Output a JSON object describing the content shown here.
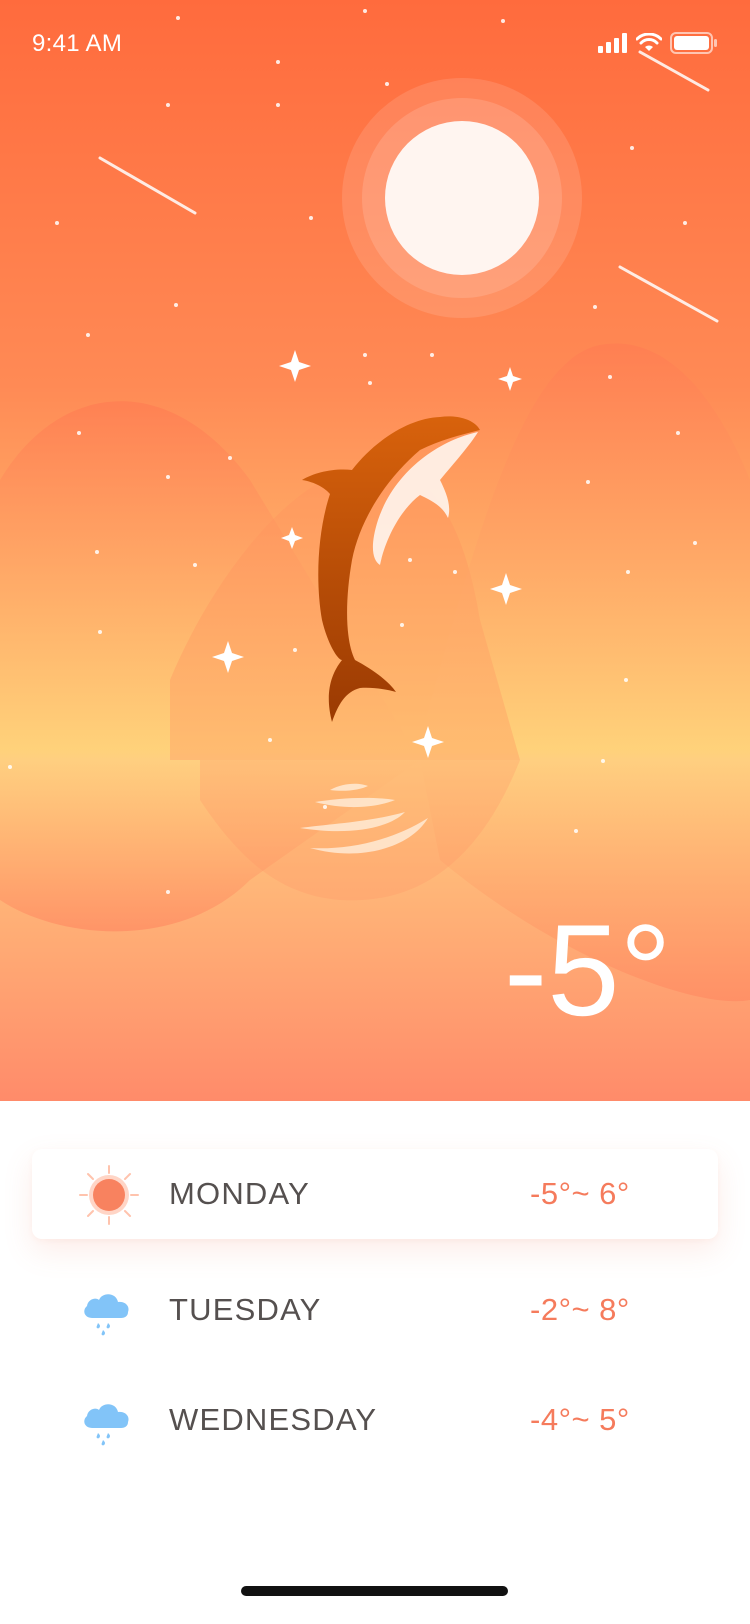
{
  "status_bar": {
    "time": "9:41 AM"
  },
  "current": {
    "temperature": "-5°"
  },
  "forecast": [
    {
      "day": "MONDAY",
      "range": "-5°~ 6°",
      "icon": "sun-icon"
    },
    {
      "day": "TUESDAY",
      "range": "-2°~ 8°",
      "icon": "rain-cloud-icon"
    },
    {
      "day": "WEDNESDAY",
      "range": "-4°~ 5°",
      "icon": "rain-cloud-icon"
    }
  ],
  "colors": {
    "sky_top": "#ff6b3d",
    "sky_bottom": "#ffd27a",
    "accent": "#f57b5c",
    "rain_icon": "#82c4f8"
  }
}
